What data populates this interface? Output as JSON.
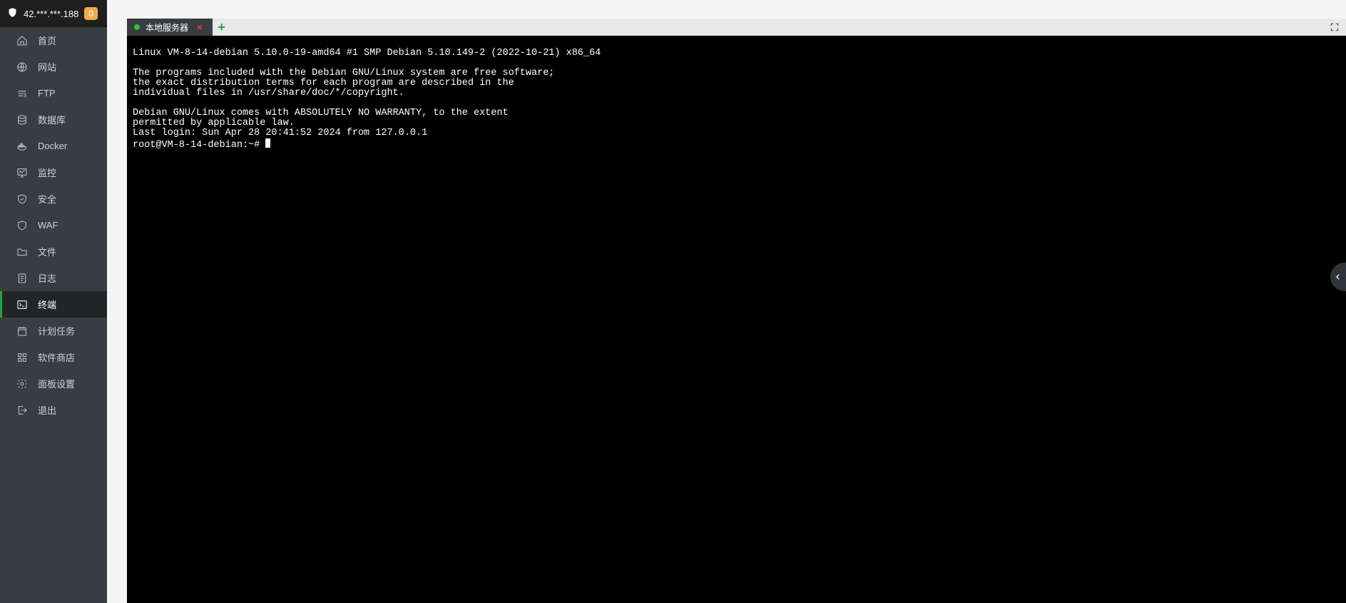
{
  "header": {
    "ip": "42.***.***.188",
    "badge": "0"
  },
  "sidebar": {
    "items": [
      {
        "label": "首页",
        "icon": "home-icon",
        "active": false
      },
      {
        "label": "网站",
        "icon": "globe-icon",
        "active": false
      },
      {
        "label": "FTP",
        "icon": "ftp-icon",
        "active": false
      },
      {
        "label": "数据库",
        "icon": "database-icon",
        "active": false
      },
      {
        "label": "Docker",
        "icon": "docker-icon",
        "active": false
      },
      {
        "label": "监控",
        "icon": "monitor-icon",
        "active": false
      },
      {
        "label": "安全",
        "icon": "shield-icon",
        "active": false
      },
      {
        "label": "WAF",
        "icon": "waf-icon",
        "active": false
      },
      {
        "label": "文件",
        "icon": "folder-icon",
        "active": false
      },
      {
        "label": "日志",
        "icon": "log-icon",
        "active": false
      },
      {
        "label": "终端",
        "icon": "terminal-icon",
        "active": true
      },
      {
        "label": "计划任务",
        "icon": "calendar-icon",
        "active": false
      },
      {
        "label": "软件商店",
        "icon": "apps-icon",
        "active": false
      },
      {
        "label": "面板设置",
        "icon": "gear-icon",
        "active": false
      },
      {
        "label": "退出",
        "icon": "exit-icon",
        "active": false
      }
    ]
  },
  "tab": {
    "label": "本地服务器"
  },
  "terminal": {
    "lines": [
      "Linux VM-8-14-debian 5.10.0-19-amd64 #1 SMP Debian 5.10.149-2 (2022-10-21) x86_64",
      "",
      "The programs included with the Debian GNU/Linux system are free software;",
      "the exact distribution terms for each program are described in the",
      "individual files in /usr/share/doc/*/copyright.",
      "",
      "Debian GNU/Linux comes with ABSOLUTELY NO WARRANTY, to the extent",
      "permitted by applicable law.",
      "Last login: Sun Apr 28 20:41:52 2024 from 127.0.0.1"
    ],
    "prompt": "root@VM-8-14-debian:~# "
  }
}
